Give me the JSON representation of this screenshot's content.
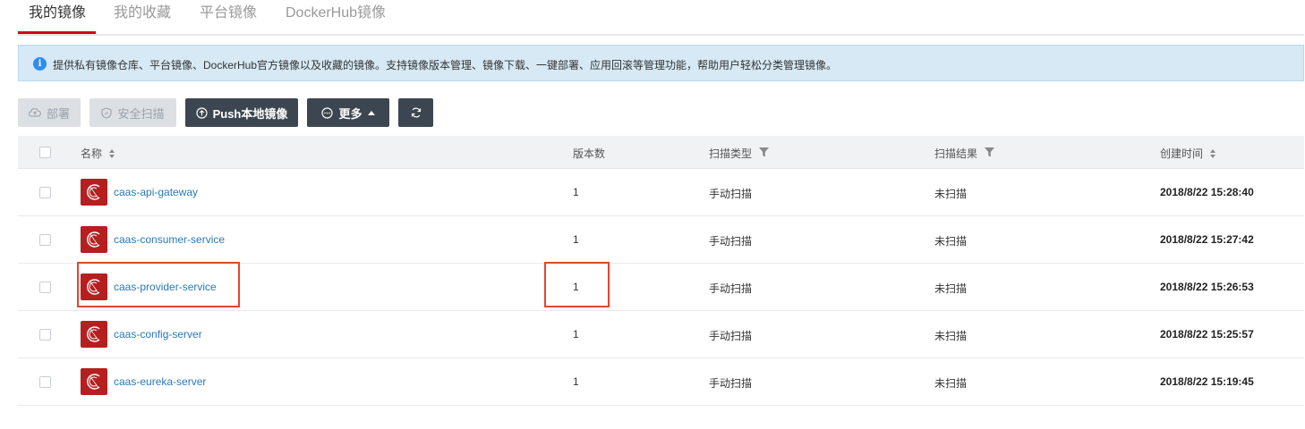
{
  "tabs": [
    {
      "label": "我的镜像"
    },
    {
      "label": "我的收藏"
    },
    {
      "label": "平台镜像"
    },
    {
      "label": "DockerHub镜像"
    }
  ],
  "banner": {
    "icon": "info-icon",
    "text": "提供私有镜像仓库、平台镜像、DockerHub官方镜像以及收藏的镜像。支持镜像版本管理、镜像下载、一键部署、应用回滚等管理功能，帮助用户轻松分类管理镜像。"
  },
  "toolbar": {
    "deploy": "部署",
    "scan": "安全扫描",
    "push": "Push本地镜像",
    "more": "更多"
  },
  "table": {
    "headers": {
      "name": "名称",
      "versions": "版本数",
      "scan_type": "扫描类型",
      "scan_result": "扫描结果",
      "created": "创建时间"
    },
    "rows": [
      {
        "name": "caas-api-gateway",
        "versions": "1",
        "scan_type": "手动扫描",
        "scan_result": "未扫描",
        "created": "2018/8/22 15:28:40"
      },
      {
        "name": "caas-consumer-service",
        "versions": "1",
        "scan_type": "手动扫描",
        "scan_result": "未扫描",
        "created": "2018/8/22 15:27:42"
      },
      {
        "name": "caas-provider-service",
        "versions": "1",
        "scan_type": "手动扫描",
        "scan_result": "未扫描",
        "created": "2018/8/22 15:26:53"
      },
      {
        "name": "caas-config-server",
        "versions": "1",
        "scan_type": "手动扫描",
        "scan_result": "未扫描",
        "created": "2018/8/22 15:25:57"
      },
      {
        "name": "caas-eureka-server",
        "versions": "1",
        "scan_type": "手动扫描",
        "scan_result": "未扫描",
        "created": "2018/8/22 15:19:45"
      }
    ]
  },
  "colors": {
    "accent": "#d0021b",
    "link": "#2a7ab8",
    "highlight": "#e8432e",
    "dark_button": "#3c4650"
  }
}
